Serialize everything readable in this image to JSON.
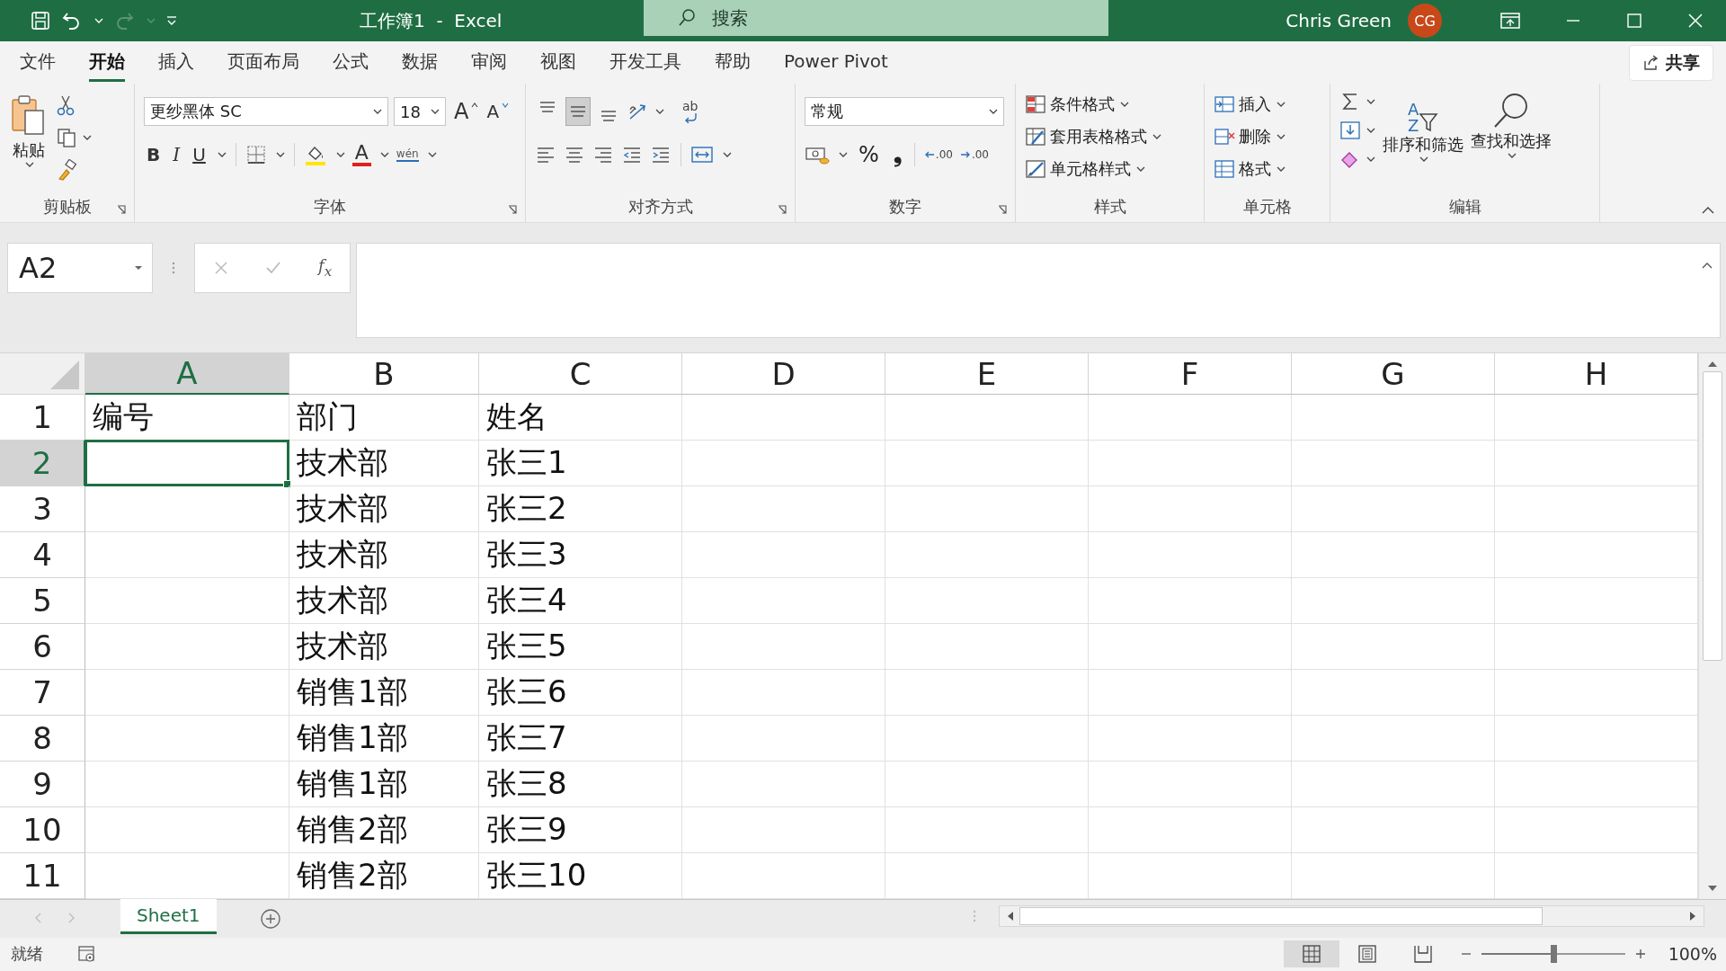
{
  "title_bar": {
    "title": "工作簿1  -  Excel",
    "search_placeholder": "搜索",
    "user": "Chris Green",
    "avatar": "CG"
  },
  "menu_tabs": [
    {
      "label": "文件",
      "selected": false
    },
    {
      "label": "开始",
      "selected": true
    },
    {
      "label": "插入",
      "selected": false
    },
    {
      "label": "页面布局",
      "selected": false
    },
    {
      "label": "公式",
      "selected": false
    },
    {
      "label": "数据",
      "selected": false
    },
    {
      "label": "审阅",
      "selected": false
    },
    {
      "label": "视图",
      "selected": false
    },
    {
      "label": "开发工具",
      "selected": false
    },
    {
      "label": "帮助",
      "selected": false
    },
    {
      "label": "Power Pivot",
      "selected": false
    }
  ],
  "share_button": "共享",
  "ribbon": {
    "clipboard": {
      "group": "剪贴板",
      "paste": "粘贴"
    },
    "font": {
      "group": "字体",
      "font_name": "更纱黑体 SC",
      "font_size": "18",
      "grow": "A",
      "shrink": "A",
      "bold": "B",
      "italic": "I",
      "underline": "U",
      "font_color": "A",
      "phonetic": "wén"
    },
    "alignment": {
      "group": "对齐方式",
      "wrap_text": "ab",
      "vertical": [
        {
          "selected": false
        },
        {
          "selected": true
        },
        {
          "selected": false
        }
      ]
    },
    "number": {
      "group": "数字",
      "format": "常规",
      "percent": "%",
      "comma": "❟",
      "increase_decimal": ".00",
      "decrease_decimal": ".00"
    },
    "styles": {
      "group": "样式",
      "items": [
        "条件格式",
        "套用表格格式",
        "单元格样式"
      ]
    },
    "cells": {
      "group": "单元格",
      "items": [
        "插入",
        "删除",
        "格式"
      ]
    },
    "editing": {
      "group": "编辑",
      "sort": "排序和筛选",
      "find": "查找和选择",
      "sort_letters": "AZ"
    }
  },
  "name_box": "A2",
  "fx_label": "f$_{x}$",
  "sheet": {
    "columns": [
      {
        "label": "A",
        "selected": true
      },
      {
        "label": "B",
        "selected": false
      },
      {
        "label": "C",
        "selected": false
      },
      {
        "label": "D",
        "selected": false
      },
      {
        "label": "E",
        "selected": false
      },
      {
        "label": "F",
        "selected": false
      },
      {
        "label": "G",
        "selected": false
      },
      {
        "label": "H",
        "selected": false
      }
    ],
    "rows": [
      {
        "label": "1",
        "selected": false,
        "cells": [
          {
            "text": "编号",
            "selected": false
          },
          {
            "text": "部门",
            "selected": false
          },
          {
            "text": "姓名",
            "selected": false
          }
        ]
      },
      {
        "label": "2",
        "selected": true,
        "cells": [
          {
            "selected": true
          },
          {
            "text": "技术部",
            "selected": false
          },
          {
            "text": "张三1",
            "selected": false
          }
        ]
      },
      {
        "label": "3",
        "selected": false,
        "cells": [
          {
            "selected": false
          },
          {
            "text": "技术部",
            "selected": false
          },
          {
            "text": "张三2",
            "selected": false
          }
        ]
      },
      {
        "label": "4",
        "selected": false,
        "cells": [
          {
            "selected": false
          },
          {
            "text": "技术部",
            "selected": false
          },
          {
            "text": "张三3",
            "selected": false
          }
        ]
      },
      {
        "label": "5",
        "selected": false,
        "cells": [
          {
            "selected": false
          },
          {
            "text": "技术部",
            "selected": false
          },
          {
            "text": "张三4",
            "selected": false
          }
        ]
      },
      {
        "label": "6",
        "selected": false,
        "cells": [
          {
            "selected": false
          },
          {
            "text": "技术部",
            "selected": false
          },
          {
            "text": "张三5",
            "selected": false
          }
        ]
      },
      {
        "label": "7",
        "selected": false,
        "cells": [
          {
            "selected": false
          },
          {
            "text": "销售1部",
            "selected": false
          },
          {
            "text": "张三6",
            "selected": false
          }
        ]
      },
      {
        "label": "8",
        "selected": false,
        "cells": [
          {
            "selected": false
          },
          {
            "text": "销售1部",
            "selected": false
          },
          {
            "text": "张三7",
            "selected": false
          }
        ]
      },
      {
        "label": "9",
        "selected": false,
        "cells": [
          {
            "selected": false
          },
          {
            "text": "销售1部",
            "selected": false
          },
          {
            "text": "张三8",
            "selected": false
          }
        ]
      },
      {
        "label": "10",
        "selected": false,
        "cells": [
          {
            "selected": false
          },
          {
            "text": "销售2部",
            "selected": false
          },
          {
            "text": "张三9",
            "selected": false
          }
        ]
      },
      {
        "label": "11",
        "selected": false,
        "cells": [
          {
            "selected": false
          },
          {
            "text": "销售2部",
            "selected": false
          },
          {
            "text": "张三10",
            "selected": false
          }
        ]
      }
    ]
  },
  "sheet_tabs": [
    {
      "label": "Sheet1",
      "selected": true
    }
  ],
  "status_bar": {
    "status": "就绪",
    "views": [
      {
        "selected": true
      },
      {
        "selected": false
      },
      {
        "selected": false
      }
    ],
    "zoom": {
      "level": 0.5
    },
    "zoom_text": "100%"
  }
}
